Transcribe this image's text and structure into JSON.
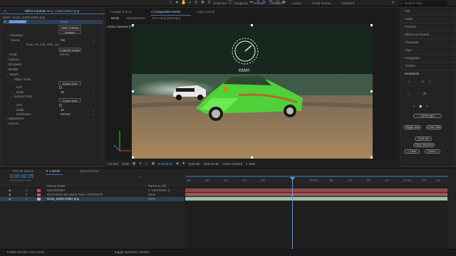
{
  "toolbar": {
    "universal_label": "Universal",
    "snapping_label": "Snapping",
    "workspaces": [
      "Default",
      "Review",
      "Learn",
      "Small Screen",
      "Standard"
    ],
    "search_placeholder": "Search Help"
  },
  "effect_controls": {
    "tab_label": "Effect Controls",
    "tab_file": "lens_11000-10667.png",
    "breadcrumb": "MAIN · lense_11000-10667.png",
    "effect_name": "GeoTracker",
    "reset_label": "Reset",
    "open_btn": "Open Tracker",
    "analyze_btn": "Analyze",
    "geometry_label": "Geometry",
    "source_label": "Source",
    "source_value": "File",
    "file_value": "bmw_m3_e46_shell_x10",
    "load3d_btn": "Load 3D model",
    "scale_label": "Scale",
    "scale_value": "100.0%",
    "camera_label": "Camera",
    "shaders_label": "2D Masks",
    "results_label": "Results",
    "export_label": "Export",
    "object_track_label": "Object Track",
    "export_null_btn": "Export Null",
    "link_label": "Link",
    "mode_label": "Mode",
    "mode_value": "3D",
    "surface_point_label": "Surface Point",
    "export_null_btn2": "Export Null",
    "link_label2": "Link",
    "mode_label2": "Mode",
    "mode_value2": "3D",
    "orientation_label": "Orientation",
    "orientation_value": "Normal",
    "appearance_label": "Appearance",
    "license_label": "License"
  },
  "composition": {
    "footage_tab": "Footage (none)",
    "comp_tab": "Composition MAIN",
    "layer_tab": "Layer (none)",
    "subtabs": [
      "MAIN",
      "Speedometer",
      "Pre-comp (Speedo)"
    ],
    "camera_label": "Active Camera (Camera)",
    "zoom": "(76.2%)",
    "resolution": "(Full)",
    "timecode": "0:00:00:25",
    "renderer": "Draft 3D",
    "renderer2": "Cinema 4D",
    "view": "Active Camera",
    "view_count": "1 View",
    "speed_text": "KM/H"
  },
  "right_panel": {
    "items": [
      "Info",
      "Audio",
      "Preview",
      "Effects & Presets",
      "Character",
      "Align",
      "Paragraph",
      "Tracker",
      "Keentools"
    ],
    "center_geo": "Center geo",
    "toggle_pins": "Toggle pins",
    "clear_pins": "Clear pins",
    "clear_all": "Clear all",
    "clear_between": "Clear between",
    "clear_left": "< Clear",
    "clear_right": "Clear >"
  },
  "timeline": {
    "render_queue_tab": "Render Queue",
    "main_tab": "MAIN",
    "speedometer_tab": "Speedometer",
    "timecode": "0:00:00:25",
    "fps_info": "00025 (29.97 fps)",
    "col_source": "Source Name",
    "col_parent": "Parent & Link",
    "layers": [
      {
        "num": "1",
        "name": "Speedometer",
        "parent": "2. GeoTracker 3"
      },
      {
        "num": "2",
        "name": "GeoTracker 3D Linked Track 1279420375",
        "parent": "None"
      },
      {
        "num": "3",
        "name": "lense_11000-10667.png",
        "parent": "None"
      }
    ],
    "ruler": [
      "00f",
      "05f",
      "10f",
      "15f",
      "20f",
      "00:00f",
      "05f",
      "10f",
      "15f",
      "20f",
      "02:00f",
      "05f",
      "10f",
      "15f"
    ],
    "frame_render_time": "Frame Render Time 31ms",
    "toggle_modes": "Toggle Switches / Modes"
  },
  "colors": {
    "accent": "#4b9cff",
    "track_red": "#b05a5a",
    "track_green": "#9fc0a8",
    "playhead": "#4b9cff",
    "car_green": "#4fd13a"
  }
}
